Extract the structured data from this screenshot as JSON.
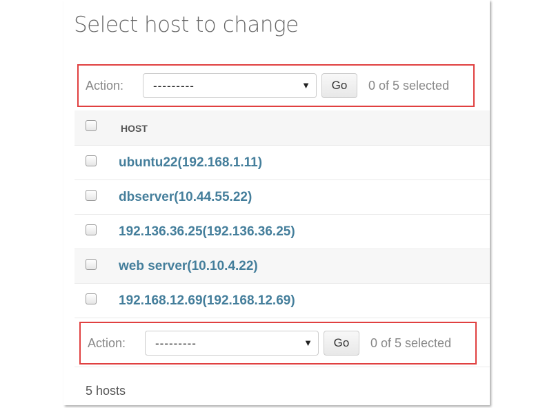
{
  "page_title": "Select host to change",
  "action_bar": {
    "label": "Action:",
    "select_value": "---------",
    "go_label": "Go",
    "selection_count": "0 of 5 selected"
  },
  "table": {
    "column_header": "HOST",
    "rows": [
      {
        "label": "ubuntu22(192.168.1.11)"
      },
      {
        "label": "dbserver(10.44.55.22)"
      },
      {
        "label": "192.136.36.25(192.136.36.25)"
      },
      {
        "label": "web server(10.10.4.22)"
      },
      {
        "label": "192.168.12.69(192.168.12.69)"
      }
    ]
  },
  "paginator": "5 hosts",
  "colors": {
    "link": "#447e9b",
    "highlight_border": "#e04040"
  }
}
